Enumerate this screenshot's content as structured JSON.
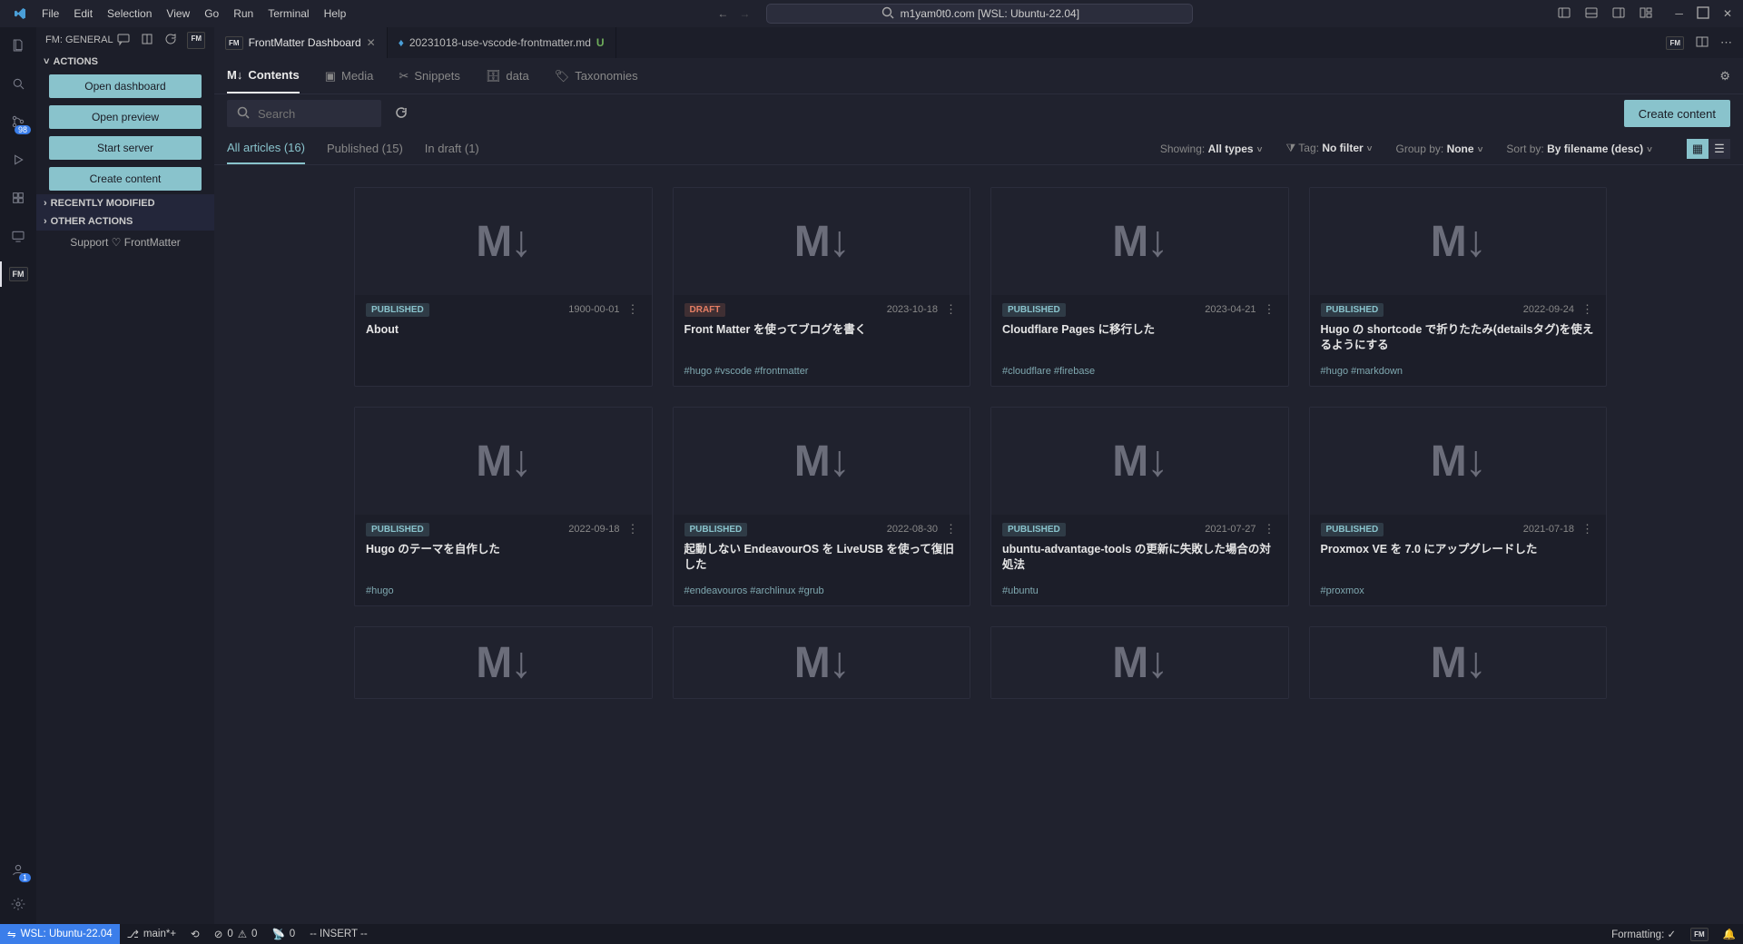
{
  "titlebar": {
    "menu": [
      "File",
      "Edit",
      "Selection",
      "View",
      "Go",
      "Run",
      "Terminal",
      "Help"
    ],
    "search_text": "m1yam0t0.com [WSL: Ubuntu-22.04]"
  },
  "activity": {
    "scm_badge": "98",
    "account_badge": "1"
  },
  "sidebar": {
    "title": "FM: GENERAL",
    "sections": {
      "actions": "ACTIONS",
      "recent": "RECENTLY MODIFIED",
      "other": "OTHER ACTIONS"
    },
    "buttons": {
      "open_dashboard": "Open dashboard",
      "open_preview": "Open preview",
      "start_server": "Start server",
      "create_content": "Create content"
    },
    "support_prefix": "Support",
    "support_link": "FrontMatter"
  },
  "tabs": {
    "t1": "FrontMatter Dashboard",
    "t2": "20231018-use-vscode-frontmatter.md",
    "t2_status": "U"
  },
  "dash": {
    "tabs": {
      "contents": "Contents",
      "media": "Media",
      "snippets": "Snippets",
      "data": "data",
      "taxonomies": "Taxonomies"
    },
    "search_placeholder": "Search",
    "create_btn": "Create content",
    "filters": {
      "all": "All articles (16)",
      "published": "Published (15)",
      "draft": "In draft (1)"
    },
    "controls": {
      "showing_lbl": "Showing:",
      "showing_val": "All types",
      "tag_lbl": "Tag:",
      "tag_val": "No filter",
      "group_lbl": "Group by:",
      "group_val": "None",
      "sort_lbl": "Sort by:",
      "sort_val": "By filename (desc)"
    }
  },
  "status_labels": {
    "published": "PUBLISHED",
    "draft": "DRAFT"
  },
  "cards": [
    {
      "status": "published",
      "date": "1900-00-01",
      "title": "About",
      "tags": ""
    },
    {
      "status": "draft",
      "date": "2023-10-18",
      "title": "Front Matter を使ってブログを書く",
      "tags": "#hugo #vscode #frontmatter"
    },
    {
      "status": "published",
      "date": "2023-04-21",
      "title": "Cloudflare Pages に移行した",
      "tags": "#cloudflare #firebase"
    },
    {
      "status": "published",
      "date": "2022-09-24",
      "title": "Hugo の shortcode で折りたたみ(detailsタグ)を使えるようにする",
      "tags": "#hugo #markdown"
    },
    {
      "status": "published",
      "date": "2022-09-18",
      "title": "Hugo のテーマを自作した",
      "tags": "#hugo"
    },
    {
      "status": "published",
      "date": "2022-08-30",
      "title": "起動しない EndeavourOS を LiveUSB を使って復旧した",
      "tags": "#endeavouros #archlinux #grub"
    },
    {
      "status": "published",
      "date": "2021-07-27",
      "title": "ubuntu-advantage-tools の更新に失敗した場合の対処法",
      "tags": "#ubuntu"
    },
    {
      "status": "published",
      "date": "2021-07-18",
      "title": "Proxmox VE を 7.0 にアップグレードした",
      "tags": "#proxmox"
    }
  ],
  "statusbar": {
    "remote": "WSL: Ubuntu-22.04",
    "branch": "main*+",
    "errors": "0",
    "warnings": "0",
    "ports": "0",
    "mode": "-- INSERT --",
    "formatting": "Formatting: ✓"
  }
}
